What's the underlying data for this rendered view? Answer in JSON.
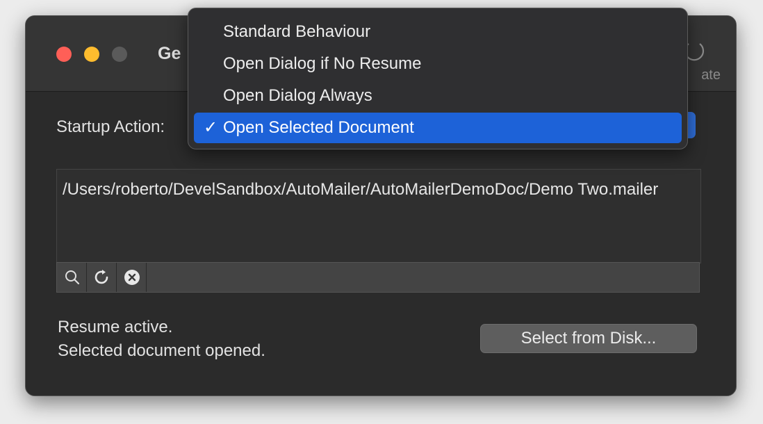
{
  "window": {
    "title": "Ge",
    "toolbar_item_label": "ate"
  },
  "startup": {
    "label": "Startup Action:"
  },
  "menu": {
    "items": [
      {
        "label": "Standard Behaviour"
      },
      {
        "label": "Open Dialog if No Resume"
      },
      {
        "label": "Open Dialog Always"
      },
      {
        "label": "Open Selected Document",
        "check": "✓"
      }
    ]
  },
  "path": {
    "text": "/Users/roberto/DevelSandbox/AutoMailer/AutoMailerDemoDoc/Demo Two.mailer"
  },
  "tools": {
    "icons": [
      "magnifier-icon",
      "refresh-icon",
      "clear-icon"
    ]
  },
  "status": {
    "line1": "Resume active.",
    "line2": "Selected document opened."
  },
  "buttons": {
    "select_from_disk": "Select from Disk..."
  },
  "colors": {
    "accent": "#1d62d8",
    "close": "#ff5f57",
    "minimize": "#febc2e"
  }
}
